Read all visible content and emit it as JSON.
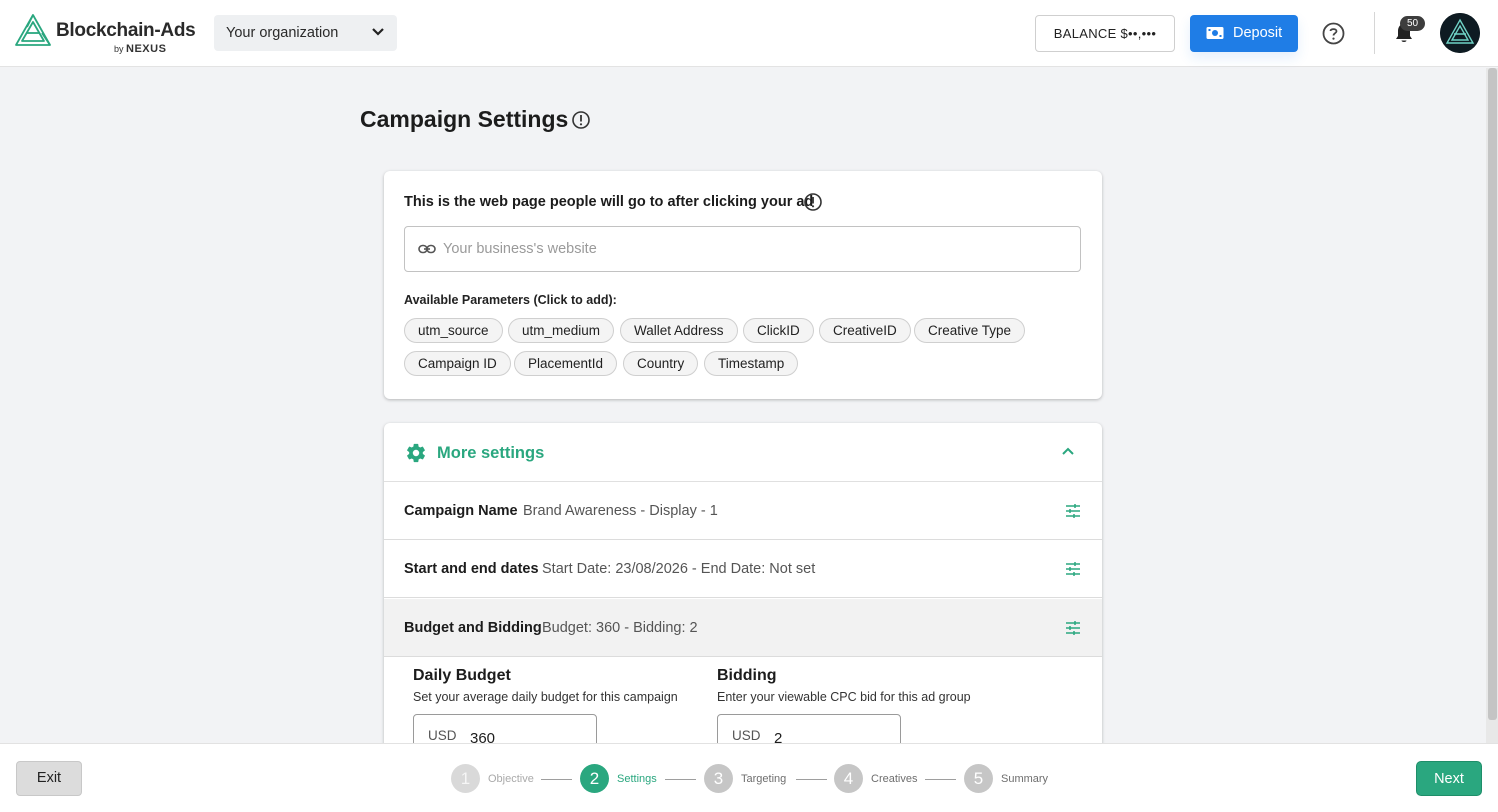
{
  "header": {
    "logo_text": "Blockchain-Ads",
    "logo_sub_by": "by",
    "logo_sub_brand": "NEXUS",
    "org_select": "Your organization",
    "balance": "BALANCE $••,•••",
    "deposit": "Deposit",
    "notifications_count": "50"
  },
  "page": {
    "title": "Campaign Settings"
  },
  "destination": {
    "label": "This is the web page people will go to after clicking your ad",
    "placeholder": "Your business's website",
    "value": "",
    "params_label": "Available Parameters (Click to add):",
    "params": [
      "utm_source",
      "utm_medium",
      "Wallet Address",
      "ClickID",
      "CreativeID",
      "Creative Type",
      "Campaign ID",
      "PlacementId",
      "Country",
      "Timestamp"
    ]
  },
  "more_settings": {
    "label": "More settings",
    "rows": [
      {
        "label": "Campaign Name",
        "value": "Brand Awareness - Display - 1"
      },
      {
        "label": "Start and end dates",
        "value": "Start Date: 23/08/2026 - End Date: Not set"
      },
      {
        "label": "Budget and Bidding",
        "value": "Budget: 360 - Bidding: 2"
      }
    ],
    "daily_budget": {
      "title": "Daily Budget",
      "desc": "Set your average daily budget for this campaign",
      "currency": "USD",
      "value": "360"
    },
    "bidding": {
      "title": "Bidding",
      "desc": "Enter your viewable CPC bid for this ad group",
      "currency": "USD",
      "value": "2"
    }
  },
  "footer": {
    "exit": "Exit",
    "next": "Next",
    "steps": [
      {
        "num": "1",
        "label": "Objective",
        "state": "done"
      },
      {
        "num": "2",
        "label": "Settings",
        "state": "current"
      },
      {
        "num": "3",
        "label": "Targeting",
        "state": "upcoming"
      },
      {
        "num": "4",
        "label": "Creatives",
        "state": "upcoming"
      },
      {
        "num": "5",
        "label": "Summary",
        "state": "upcoming"
      }
    ]
  },
  "colors": {
    "accent_green": "#2aa77f",
    "deposit_blue": "#1f7de6",
    "page_bg": "#f2f3f5"
  }
}
